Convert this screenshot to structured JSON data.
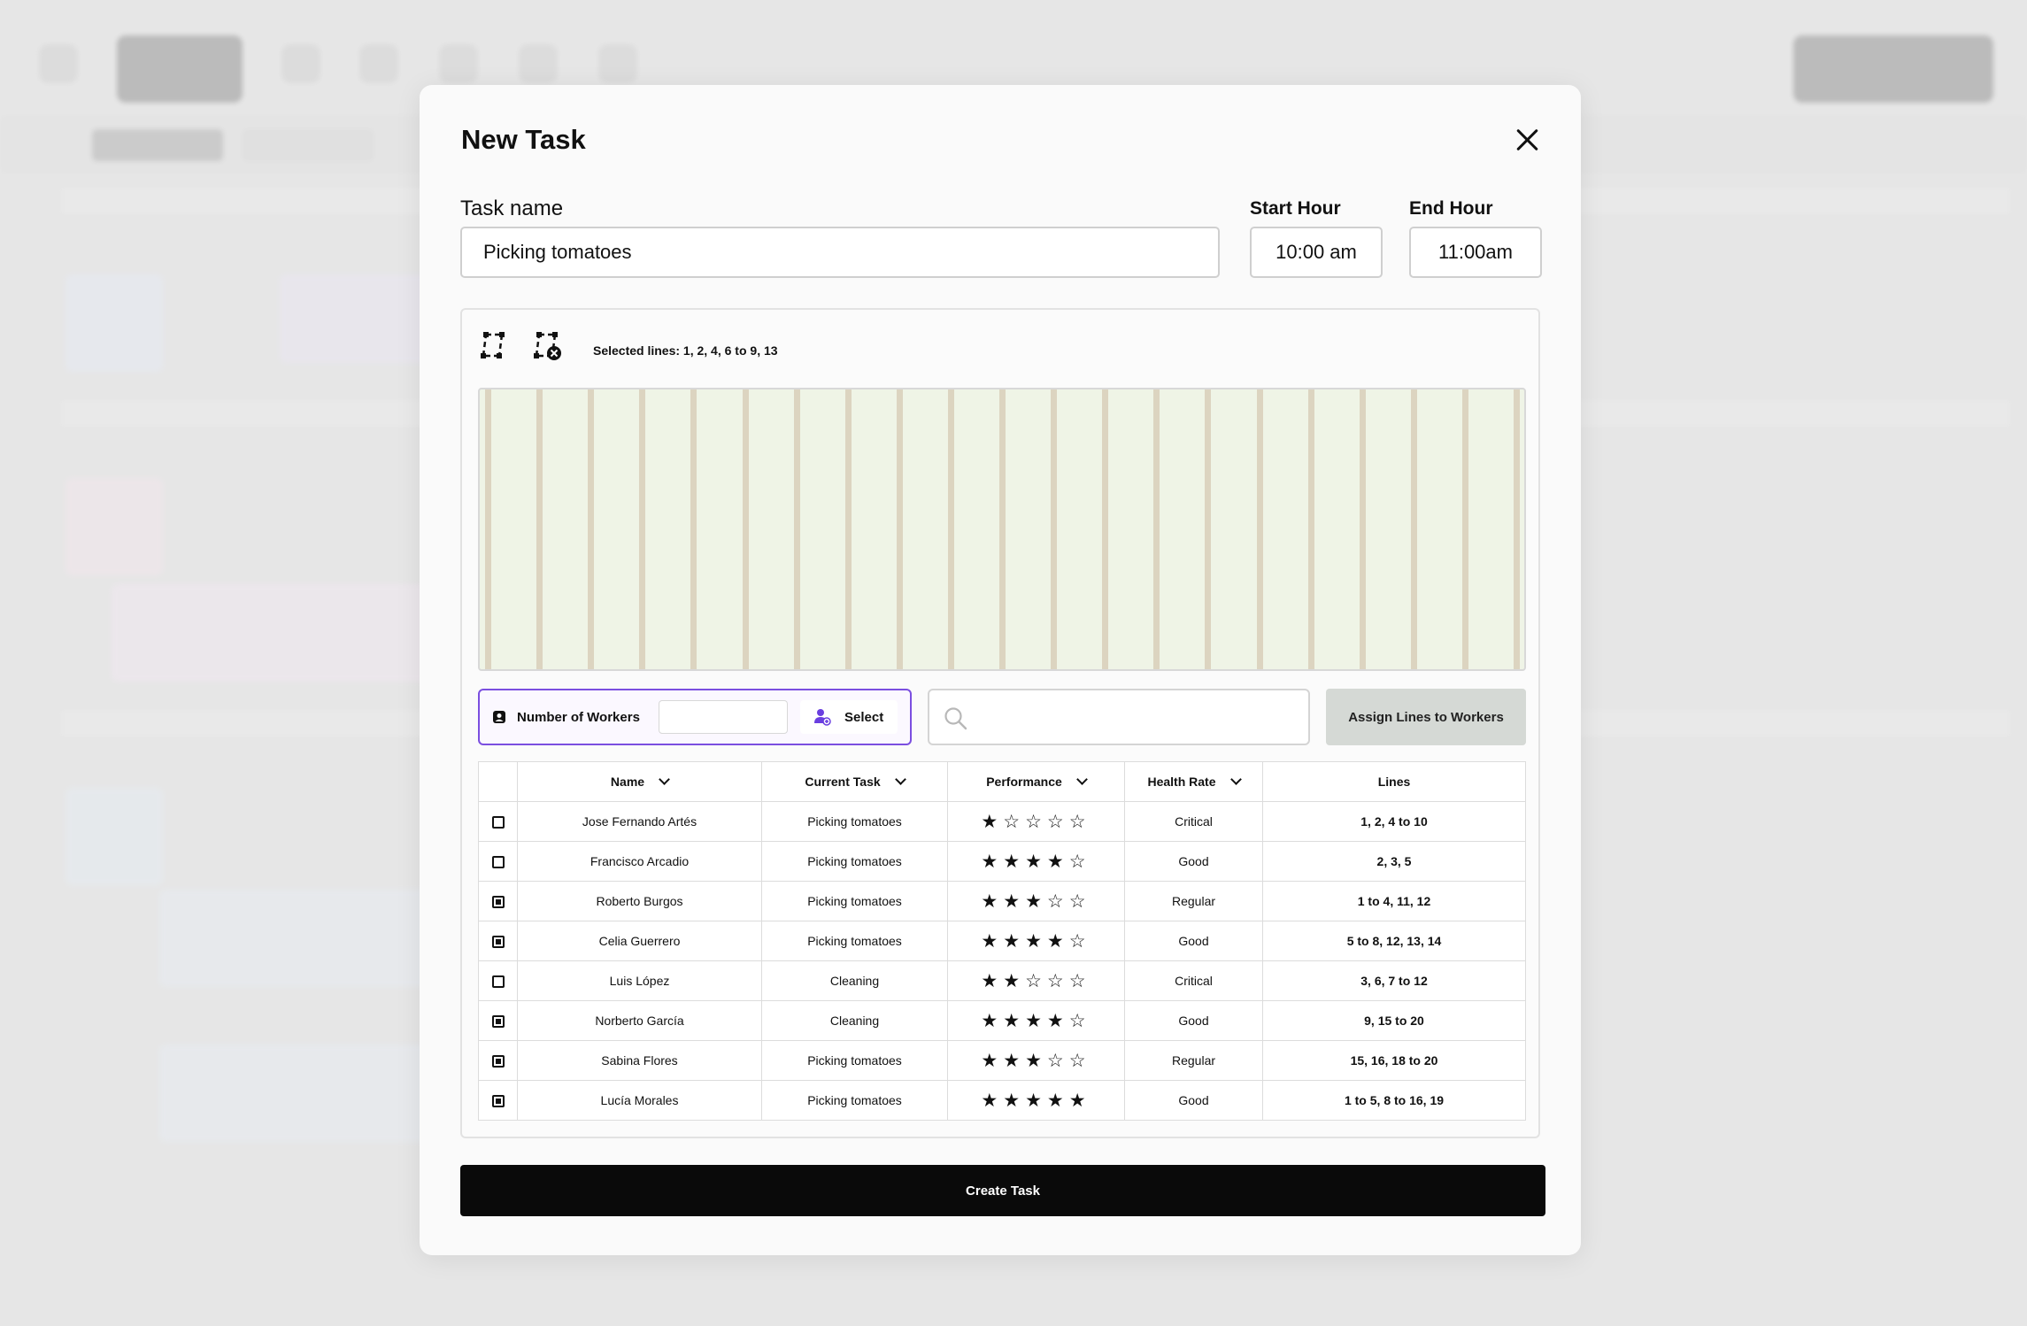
{
  "modal": {
    "title": "New Task",
    "task_name_label": "Task name",
    "task_name_value": "Picking tomatoes",
    "start_hour_label": "Start Hour",
    "start_hour_value": "10:00 am",
    "end_hour_label": "End Hour",
    "end_hour_value": "11:00am",
    "selected_lines_text": "Selected lines: 1, 2, 4, 6 to 9, 13",
    "field_line_count": 21,
    "number_of_workers_label": "Number of Workers",
    "number_of_workers_value": "",
    "select_label": "Select",
    "search_placeholder": "",
    "assign_button": "Assign Lines to Workers",
    "create_button": "Create Task"
  },
  "table": {
    "columns": [
      "Name",
      "Current Task",
      "Performance",
      "Health Rate",
      "Lines"
    ],
    "rows": [
      {
        "checked": false,
        "name": "Jose Fernando Artés",
        "task": "Picking tomatoes",
        "stars": 1,
        "health": "Critical",
        "lines": "1, 2, 4 to 10"
      },
      {
        "checked": false,
        "name": "Francisco Arcadio",
        "task": "Picking tomatoes",
        "stars": 4,
        "health": "Good",
        "lines": "2, 3, 5"
      },
      {
        "checked": true,
        "name": "Roberto Burgos",
        "task": "Picking tomatoes",
        "stars": 3,
        "health": "Regular",
        "lines": "1 to 4, 11, 12"
      },
      {
        "checked": true,
        "name": "Celia Guerrero",
        "task": "Picking tomatoes",
        "stars": 4,
        "health": "Good",
        "lines": "5 to 8, 12, 13, 14"
      },
      {
        "checked": false,
        "name": "Luis López",
        "task": "Cleaning",
        "stars": 2,
        "health": "Critical",
        "lines": "3, 6, 7 to 12"
      },
      {
        "checked": true,
        "name": "Norberto García",
        "task": "Cleaning",
        "stars": 4,
        "health": "Good",
        "lines": "9, 15 to 20"
      },
      {
        "checked": true,
        "name": "Sabina Flores",
        "task": "Picking tomatoes",
        "stars": 3,
        "health": "Regular",
        "lines": "15, 16, 18 to 20"
      },
      {
        "checked": true,
        "name": "Lucía Morales",
        "task": "Picking tomatoes",
        "stars": 5,
        "health": "Good",
        "lines": "1 to 5, 8 to 16, 19"
      }
    ]
  },
  "colors": {
    "critical": "#e03a3a",
    "good": "#1faa6a",
    "regular": "#f0a020",
    "accent": "#7b4fe0",
    "field": "#eff4e6"
  }
}
